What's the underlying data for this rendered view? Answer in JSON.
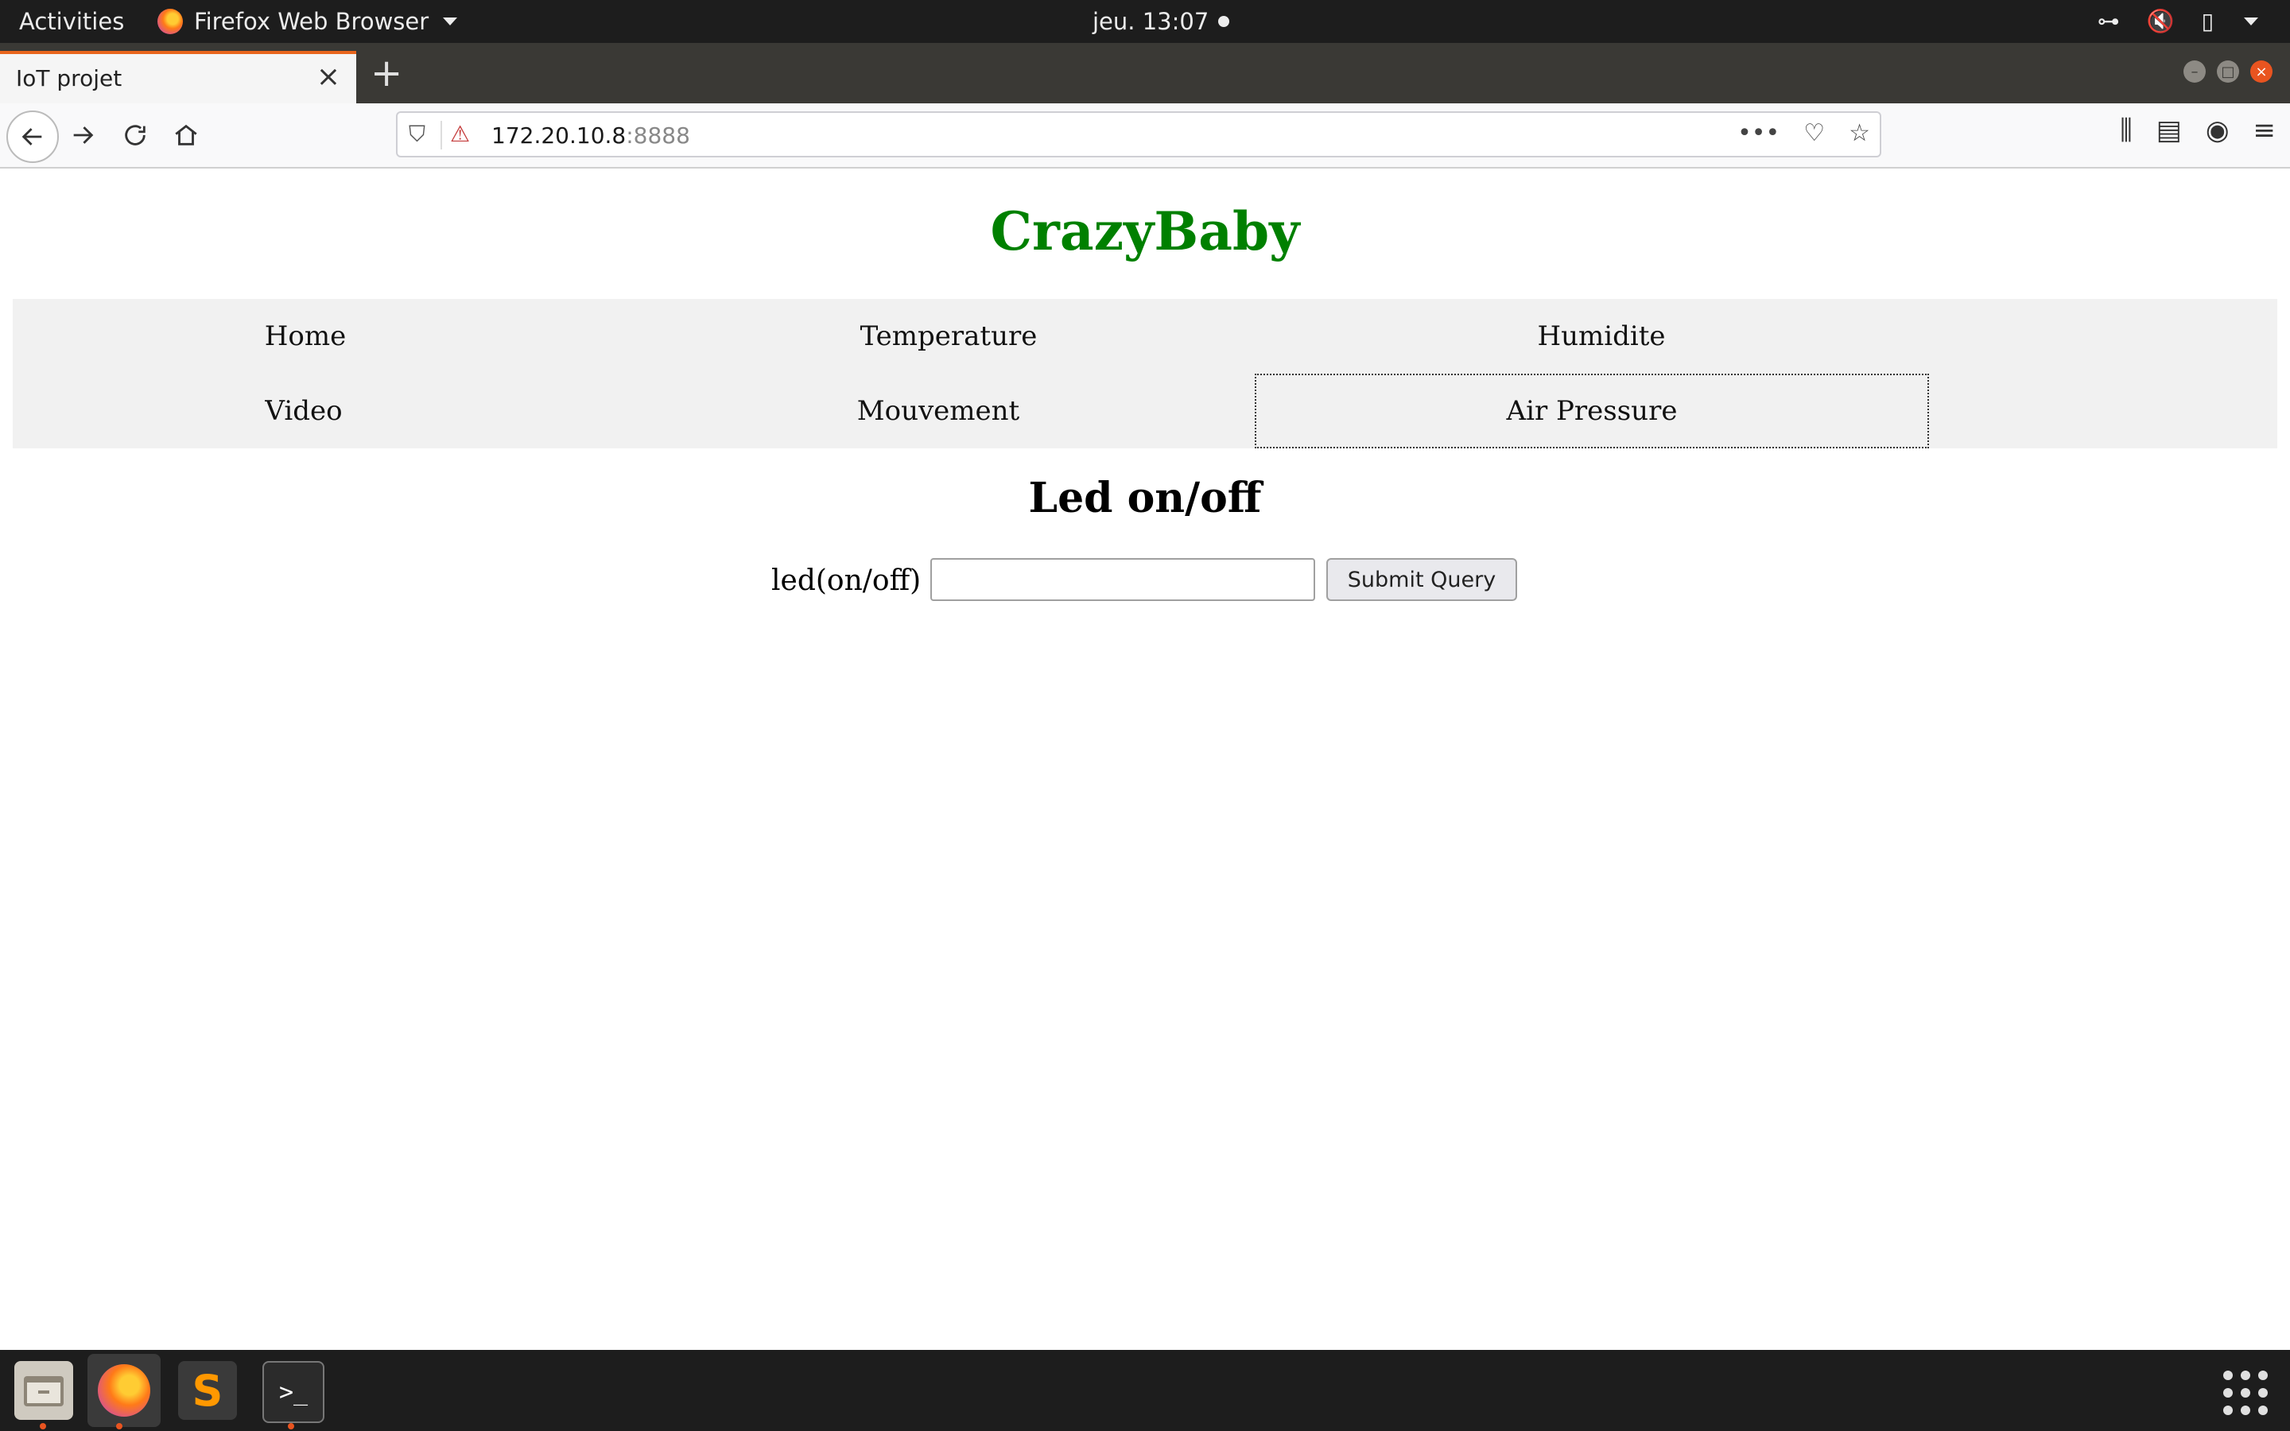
{
  "topbar": {
    "activities": "Activities",
    "app_name": "Firefox Web Browser",
    "clock": "jeu. 13:07"
  },
  "browser": {
    "tab_title": "IoT projet",
    "url_host": "172.20.10.8",
    "url_port": ":8888",
    "accent_color": "#e8651c"
  },
  "page": {
    "brand": "CrazyBaby",
    "brand_color": "#008000",
    "menu": [
      "Home",
      "Temperature",
      "Humidite",
      "Video",
      "Mouvement",
      "Air Pressure"
    ],
    "heading": "Led on/off",
    "form": {
      "label": "led(on/off) :",
      "input_value": "",
      "submit_label": "Submit Query"
    }
  },
  "icons": {
    "back": "back-arrow-icon",
    "forward": "forward-arrow-icon",
    "reload": "reload-icon",
    "home": "home-icon",
    "shield": "shield-icon",
    "insecure": "insecure-lock-icon",
    "more": "more-dots-icon",
    "pocket": "pocket-icon",
    "bookmark": "star-icon",
    "library": "library-icon",
    "sidebar": "sidebar-icon",
    "account": "account-icon",
    "menu": "hamburger-icon"
  }
}
